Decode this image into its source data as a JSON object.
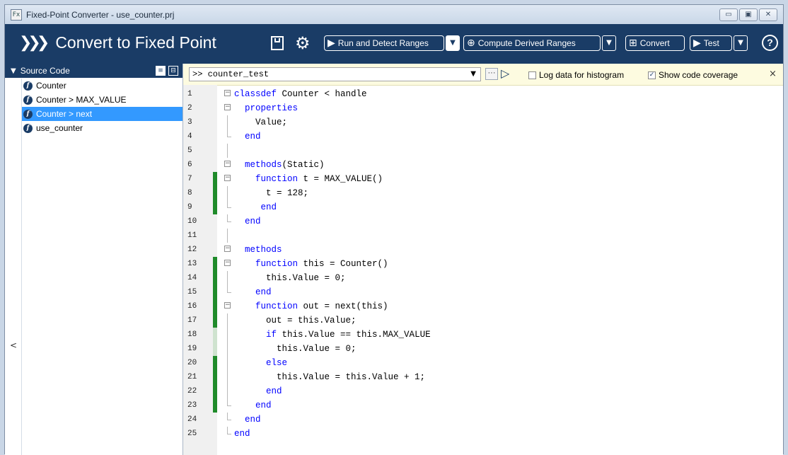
{
  "window": {
    "title": "Fixed-Point Converter - use_counter.prj",
    "app_icon": "Fx",
    "controls": [
      "minimize-icon",
      "maximize-icon",
      "close-icon"
    ]
  },
  "toolbar": {
    "title": "Convert to Fixed Point",
    "run_label": "Run and Detect Ranges",
    "derived_label": "Compute Derived Ranges",
    "convert_label": "Convert",
    "test_label": "Test",
    "help_label": "?",
    "bg_color": "#1a3c66"
  },
  "sidebar": {
    "header": "Source Code",
    "items": [
      {
        "label": "Counter",
        "icon": "function-icon",
        "selected": false
      },
      {
        "label": "Counter > MAX_VALUE",
        "icon": "function-icon",
        "selected": false
      },
      {
        "label": "Counter > next",
        "icon": "function-icon",
        "selected": true
      },
      {
        "label": "use_counter",
        "icon": "function-icon",
        "selected": false
      }
    ],
    "collapse_label": "<"
  },
  "command": {
    "value": ">> counter_test",
    "log_label": "Log data for histogram",
    "log_checked": false,
    "coverage_label": "Show code coverage",
    "coverage_checked": true,
    "close_label": "×"
  },
  "coverage_colors": {
    "full": "#1f8b2a",
    "partial": "#cfe3cf"
  },
  "code": [
    {
      "n": "1",
      "cov": "",
      "fold": "open",
      "segs": [
        [
          "k",
          "classdef"
        ],
        [
          "t",
          " Counter < handle"
        ]
      ]
    },
    {
      "n": "2",
      "cov": "",
      "fold": "open",
      "segs": [
        [
          "t",
          "  "
        ],
        [
          "k",
          "properties"
        ]
      ]
    },
    {
      "n": "3",
      "cov": "",
      "fold": "",
      "segs": [
        [
          "t",
          "    Value;"
        ]
      ]
    },
    {
      "n": "4",
      "cov": "",
      "fold": "end",
      "segs": [
        [
          "t",
          "  "
        ],
        [
          "k",
          "end"
        ]
      ]
    },
    {
      "n": "5",
      "cov": "",
      "fold": "",
      "segs": [
        [
          "t",
          ""
        ]
      ]
    },
    {
      "n": "6",
      "cov": "",
      "fold": "open",
      "segs": [
        [
          "t",
          "  "
        ],
        [
          "k",
          "methods"
        ],
        [
          "t",
          "(Static)"
        ]
      ]
    },
    {
      "n": "7",
      "cov": "full",
      "fold": "open",
      "segs": [
        [
          "t",
          "    "
        ],
        [
          "k",
          "function"
        ],
        [
          "t",
          " t = MAX_VALUE()"
        ]
      ]
    },
    {
      "n": "8",
      "cov": "full",
      "fold": "",
      "segs": [
        [
          "t",
          "      t = 128;"
        ]
      ]
    },
    {
      "n": "9",
      "cov": "full",
      "fold": "end",
      "segs": [
        [
          "t",
          "     "
        ],
        [
          "k",
          "end"
        ]
      ]
    },
    {
      "n": "10",
      "cov": "",
      "fold": "end",
      "segs": [
        [
          "t",
          "  "
        ],
        [
          "k",
          "end"
        ]
      ]
    },
    {
      "n": "11",
      "cov": "",
      "fold": "",
      "segs": [
        [
          "t",
          ""
        ]
      ]
    },
    {
      "n": "12",
      "cov": "",
      "fold": "open",
      "segs": [
        [
          "t",
          "  "
        ],
        [
          "k",
          "methods"
        ]
      ]
    },
    {
      "n": "13",
      "cov": "full",
      "fold": "open",
      "segs": [
        [
          "t",
          "    "
        ],
        [
          "k",
          "function"
        ],
        [
          "t",
          " this = Counter()"
        ]
      ]
    },
    {
      "n": "14",
      "cov": "full",
      "fold": "",
      "segs": [
        [
          "t",
          "      this.Value = 0;"
        ]
      ]
    },
    {
      "n": "15",
      "cov": "full",
      "fold": "end",
      "segs": [
        [
          "t",
          "    "
        ],
        [
          "k",
          "end"
        ]
      ]
    },
    {
      "n": "16",
      "cov": "full",
      "fold": "open",
      "segs": [
        [
          "t",
          "    "
        ],
        [
          "k",
          "function"
        ],
        [
          "t",
          " out = next(this)"
        ]
      ]
    },
    {
      "n": "17",
      "cov": "full",
      "fold": "",
      "segs": [
        [
          "t",
          "      out = this.Value;"
        ]
      ]
    },
    {
      "n": "18",
      "cov": "partial",
      "fold": "",
      "segs": [
        [
          "t",
          "      "
        ],
        [
          "k",
          "if"
        ],
        [
          "t",
          " this.Value == this.MAX_VALUE"
        ]
      ]
    },
    {
      "n": "19",
      "cov": "partial",
      "fold": "",
      "segs": [
        [
          "t",
          "        this.Value = 0;"
        ]
      ]
    },
    {
      "n": "20",
      "cov": "full",
      "fold": "",
      "segs": [
        [
          "t",
          "      "
        ],
        [
          "k",
          "else"
        ]
      ]
    },
    {
      "n": "21",
      "cov": "full",
      "fold": "",
      "segs": [
        [
          "t",
          "        this.Value = this.Value + 1;"
        ]
      ]
    },
    {
      "n": "22",
      "cov": "full",
      "fold": "",
      "segs": [
        [
          "t",
          "      "
        ],
        [
          "k",
          "end"
        ]
      ]
    },
    {
      "n": "23",
      "cov": "full",
      "fold": "end",
      "segs": [
        [
          "t",
          "    "
        ],
        [
          "k",
          "end"
        ]
      ]
    },
    {
      "n": "24",
      "cov": "",
      "fold": "end",
      "segs": [
        [
          "t",
          "  "
        ],
        [
          "k",
          "end"
        ]
      ]
    },
    {
      "n": "25",
      "cov": "",
      "fold": "last",
      "segs": [
        [
          "k",
          "end"
        ]
      ]
    }
  ]
}
